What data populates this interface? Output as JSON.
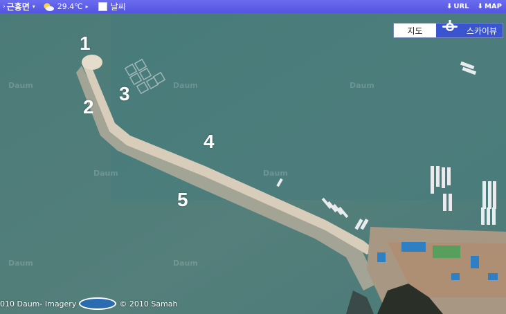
{
  "topbar": {
    "region": "근흥면",
    "temperature": "29.4℃",
    "weather_label": "날씨",
    "url_label": "URL",
    "map_label": "MAP"
  },
  "map_toggle": {
    "map_label": "지도",
    "skyview_label": "스카이뷰"
  },
  "markers": [
    "1",
    "2",
    "3",
    "4",
    "5"
  ],
  "watermark": "Daum",
  "footer": {
    "imagery": "010 Daum- Imagery",
    "samah_logo": "SAMAH",
    "copyright": "© 2010 Samah"
  },
  "colors": {
    "sea": "#4f7f7c",
    "topbar": "#5a5ce8",
    "skyview_active": "#3b54d0"
  }
}
